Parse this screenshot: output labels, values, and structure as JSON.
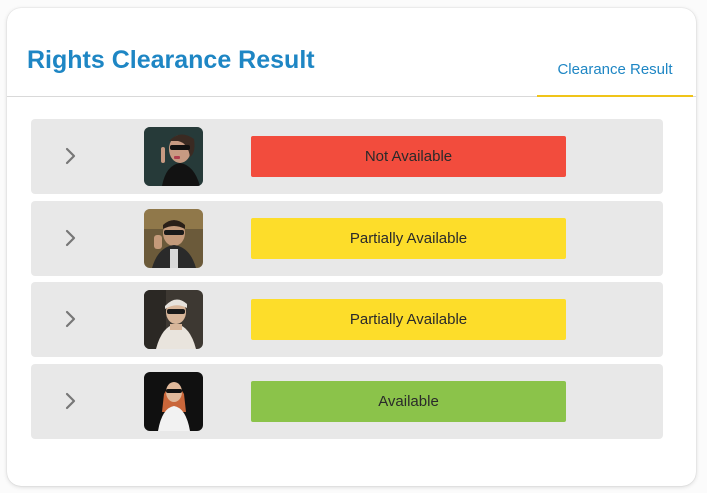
{
  "header": {
    "title": "Rights Clearance Result",
    "tab_label": "Clearance Result"
  },
  "colors": {
    "title": "#1e86c4",
    "tab_underline": "#f0c419",
    "not_available": "#f24c3d",
    "partially_available": "#fddd2a",
    "available": "#8bc34a"
  },
  "results": [
    {
      "status": "Not Available",
      "status_color": "#f24c3d",
      "expand_icon": "chevron-right-icon"
    },
    {
      "status": "Partially Available",
      "status_color": "#fddd2a",
      "expand_icon": "chevron-right-icon"
    },
    {
      "status": "Partially Available",
      "status_color": "#fddd2a",
      "expand_icon": "chevron-right-icon"
    },
    {
      "status": "Available",
      "status_color": "#8bc34a",
      "expand_icon": "chevron-right-icon"
    }
  ]
}
